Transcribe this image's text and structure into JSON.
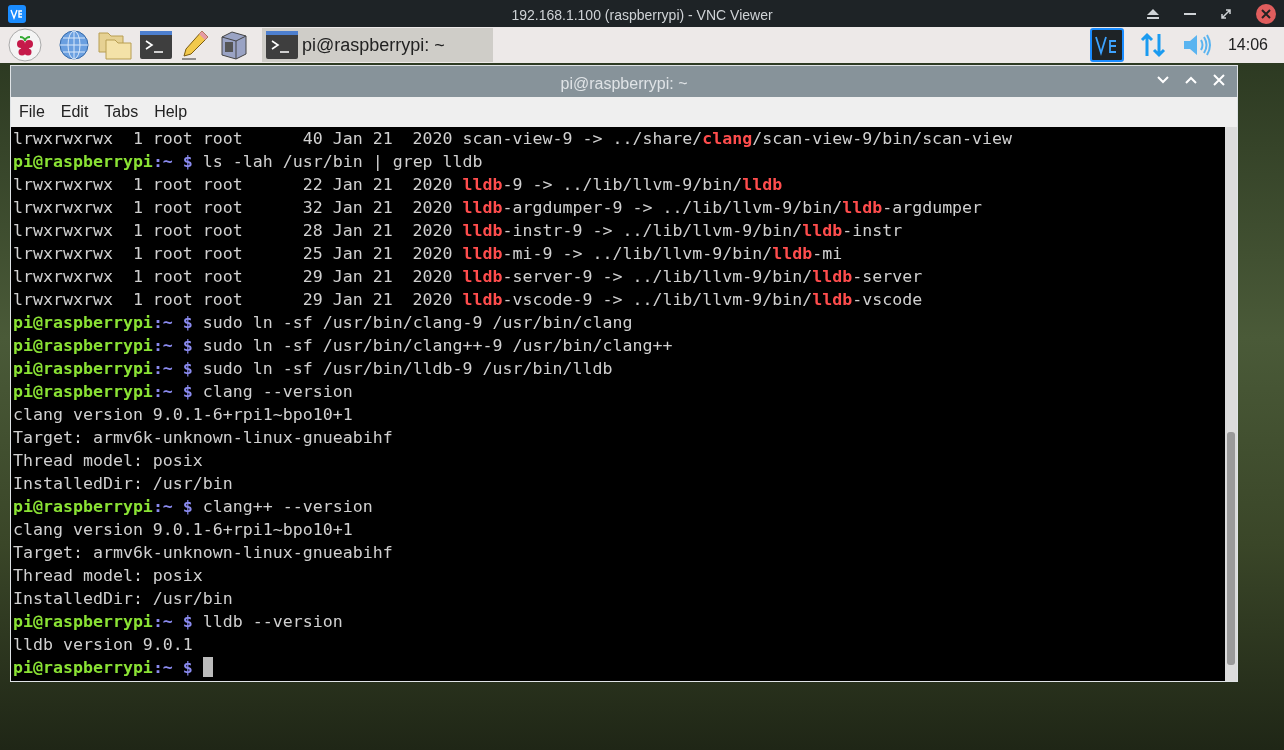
{
  "viewer": {
    "title": "192.168.1.100 (raspberrypi) - VNC Viewer"
  },
  "panel": {
    "tasks": [
      {
        "label": "pi@raspberrypi: ~",
        "selected": true
      }
    ],
    "clock": "14:06"
  },
  "terminal": {
    "title": "pi@raspberrypi: ~",
    "menu": [
      "File",
      "Edit",
      "Tabs",
      "Help"
    ],
    "lines": [
      {
        "kind": "output",
        "parts": [
          {
            "text": "lrwxrwxrwx  1 root root      40 Jan 21  2020 scan-view-9 -> ../share/",
            "hl": false
          },
          {
            "text": "clang",
            "hl": true
          },
          {
            "text": "/scan-view-9/bin/scan-view",
            "hl": false
          }
        ]
      },
      {
        "kind": "prompt",
        "user": "pi@raspberrypi",
        "dir": ":~",
        "sign": "$",
        "command": "ls -lah /usr/bin | grep lldb",
        "cursor": false
      },
      {
        "kind": "output",
        "parts": [
          {
            "text": "lrwxrwxrwx  1 root root      22 Jan 21  2020 ",
            "hl": false
          },
          {
            "text": "lldb",
            "hl": true
          },
          {
            "text": "-9 -> ../lib/llvm-9/bin/",
            "hl": false
          },
          {
            "text": "lldb",
            "hl": true
          }
        ]
      },
      {
        "kind": "output",
        "parts": [
          {
            "text": "lrwxrwxrwx  1 root root      32 Jan 21  2020 ",
            "hl": false
          },
          {
            "text": "lldb",
            "hl": true
          },
          {
            "text": "-argdumper-9 -> ../lib/llvm-9/bin/",
            "hl": false
          },
          {
            "text": "lldb",
            "hl": true
          },
          {
            "text": "-argdumper",
            "hl": false
          }
        ]
      },
      {
        "kind": "output",
        "parts": [
          {
            "text": "lrwxrwxrwx  1 root root      28 Jan 21  2020 ",
            "hl": false
          },
          {
            "text": "lldb",
            "hl": true
          },
          {
            "text": "-instr-9 -> ../lib/llvm-9/bin/",
            "hl": false
          },
          {
            "text": "lldb",
            "hl": true
          },
          {
            "text": "-instr",
            "hl": false
          }
        ]
      },
      {
        "kind": "output",
        "parts": [
          {
            "text": "lrwxrwxrwx  1 root root      25 Jan 21  2020 ",
            "hl": false
          },
          {
            "text": "lldb",
            "hl": true
          },
          {
            "text": "-mi-9 -> ../lib/llvm-9/bin/",
            "hl": false
          },
          {
            "text": "lldb",
            "hl": true
          },
          {
            "text": "-mi",
            "hl": false
          }
        ]
      },
      {
        "kind": "output",
        "parts": [
          {
            "text": "lrwxrwxrwx  1 root root      29 Jan 21  2020 ",
            "hl": false
          },
          {
            "text": "lldb",
            "hl": true
          },
          {
            "text": "-server-9 -> ../lib/llvm-9/bin/",
            "hl": false
          },
          {
            "text": "lldb",
            "hl": true
          },
          {
            "text": "-server",
            "hl": false
          }
        ]
      },
      {
        "kind": "output",
        "parts": [
          {
            "text": "lrwxrwxrwx  1 root root      29 Jan 21  2020 ",
            "hl": false
          },
          {
            "text": "lldb",
            "hl": true
          },
          {
            "text": "-vscode-9 -> ../lib/llvm-9/bin/",
            "hl": false
          },
          {
            "text": "lldb",
            "hl": true
          },
          {
            "text": "-vscode",
            "hl": false
          }
        ]
      },
      {
        "kind": "prompt",
        "user": "pi@raspberrypi",
        "dir": ":~",
        "sign": "$",
        "command": "sudo ln -sf /usr/bin/clang-9 /usr/bin/clang",
        "cursor": false
      },
      {
        "kind": "prompt",
        "user": "pi@raspberrypi",
        "dir": ":~",
        "sign": "$",
        "command": "sudo ln -sf /usr/bin/clang++-9 /usr/bin/clang++",
        "cursor": false
      },
      {
        "kind": "prompt",
        "user": "pi@raspberrypi",
        "dir": ":~",
        "sign": "$",
        "command": "sudo ln -sf /usr/bin/lldb-9 /usr/bin/lldb",
        "cursor": false
      },
      {
        "kind": "prompt",
        "user": "pi@raspberrypi",
        "dir": ":~",
        "sign": "$",
        "command": "clang --version",
        "cursor": false
      },
      {
        "kind": "output",
        "parts": [
          {
            "text": "clang version 9.0.1-6+rpi1~bpo10+1",
            "hl": false
          }
        ]
      },
      {
        "kind": "output",
        "parts": [
          {
            "text": "Target: armv6k-unknown-linux-gnueabihf",
            "hl": false
          }
        ]
      },
      {
        "kind": "output",
        "parts": [
          {
            "text": "Thread model: posix",
            "hl": false
          }
        ]
      },
      {
        "kind": "output",
        "parts": [
          {
            "text": "InstalledDir: /usr/bin",
            "hl": false
          }
        ]
      },
      {
        "kind": "prompt",
        "user": "pi@raspberrypi",
        "dir": ":~",
        "sign": "$",
        "command": "clang++ --version",
        "cursor": false
      },
      {
        "kind": "output",
        "parts": [
          {
            "text": "clang version 9.0.1-6+rpi1~bpo10+1",
            "hl": false
          }
        ]
      },
      {
        "kind": "output",
        "parts": [
          {
            "text": "Target: armv6k-unknown-linux-gnueabihf",
            "hl": false
          }
        ]
      },
      {
        "kind": "output",
        "parts": [
          {
            "text": "Thread model: posix",
            "hl": false
          }
        ]
      },
      {
        "kind": "output",
        "parts": [
          {
            "text": "InstalledDir: /usr/bin",
            "hl": false
          }
        ]
      },
      {
        "kind": "prompt",
        "user": "pi@raspberrypi",
        "dir": ":~",
        "sign": "$",
        "command": "lldb --version",
        "cursor": false
      },
      {
        "kind": "output",
        "parts": [
          {
            "text": "lldb version 9.0.1",
            "hl": false
          }
        ]
      },
      {
        "kind": "prompt",
        "user": "pi@raspberrypi",
        "dir": ":~",
        "sign": "$",
        "cursor": true
      }
    ]
  }
}
